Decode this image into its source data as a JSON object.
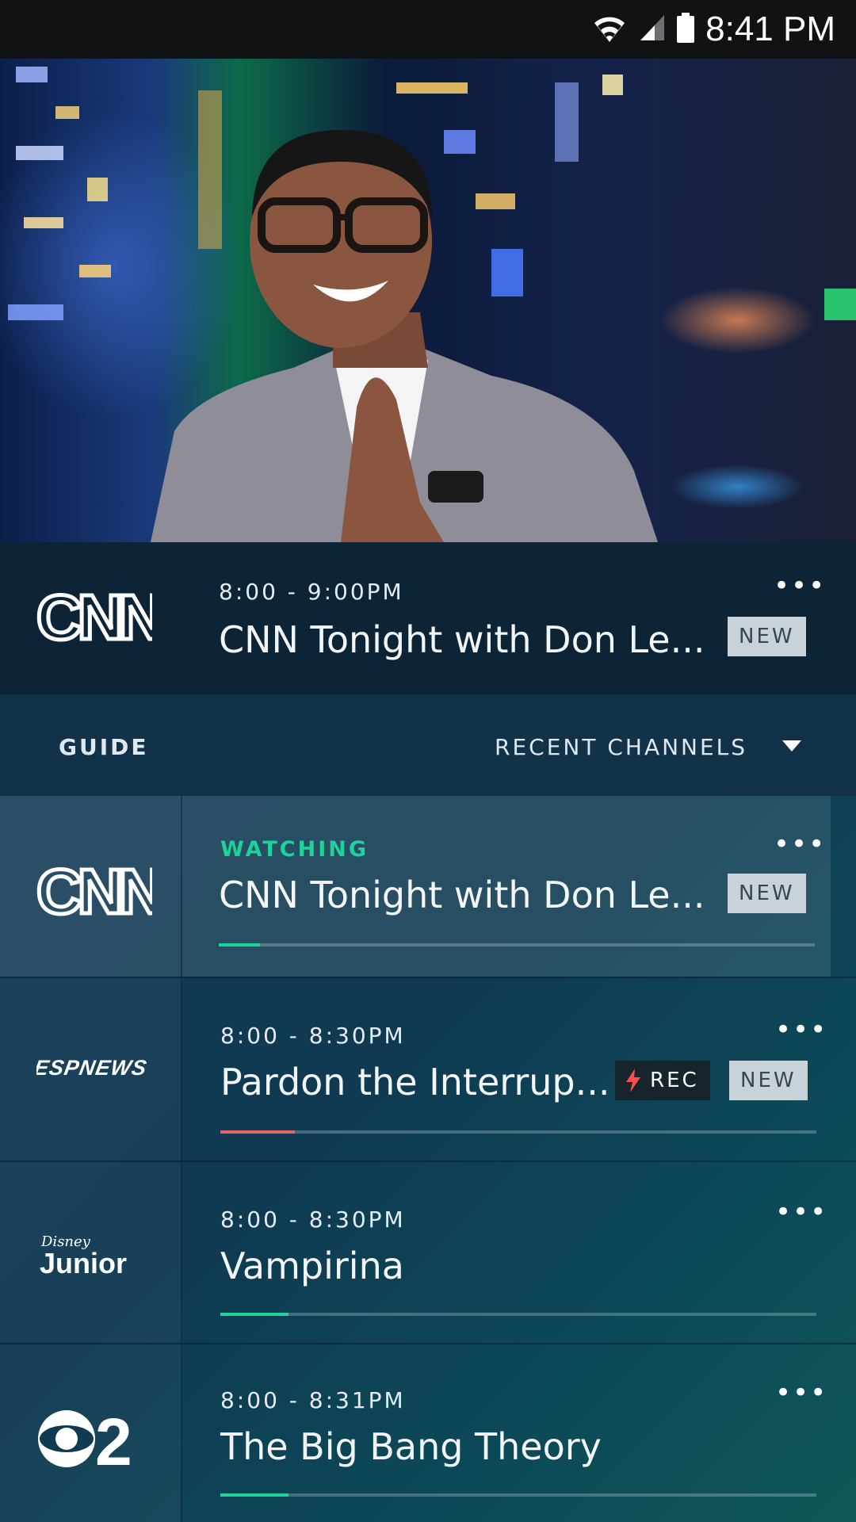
{
  "status_bar": {
    "time": "8:41 PM"
  },
  "now_playing": {
    "channel": "CNN",
    "time": "8:00 - 9:00PM",
    "title": "CNN Tonight with Don Le...",
    "badge": "NEW"
  },
  "guide_bar": {
    "guide_label": "GUIDE",
    "filter_label": "RECENT CHANNELS"
  },
  "guide_rows": [
    {
      "channel": "CNN",
      "status": "WATCHING",
      "time": "",
      "title": "CNN Tonight with Don Le...",
      "badges": [
        "NEW"
      ],
      "progress": 0.07,
      "progress_color": "#1ed39a"
    },
    {
      "channel": "ESPNEWS",
      "status": "",
      "time": "8:00 - 8:30PM",
      "title": "Pardon the Interrup...",
      "badges": [
        "REC",
        "NEW"
      ],
      "progress": 0.12,
      "progress_color": "#e5636a"
    },
    {
      "channel": "Disney Junior",
      "status": "",
      "time": "8:00 - 8:30PM",
      "title": "Vampirina",
      "badges": [],
      "progress": 0.11,
      "progress_color": "#1ed39a"
    },
    {
      "channel": "CBS 2",
      "status": "",
      "time": "8:00 - 8:31PM",
      "title": "The Big Bang Theory",
      "badges": [],
      "progress": 0.11,
      "progress_color": "#1ed39a"
    }
  ],
  "colors": {
    "accent_green": "#1ed39a",
    "rec_red": "#e5636a",
    "badge_bg": "#c9d2d8"
  },
  "icons": [
    "wifi-icon",
    "signal-icon",
    "battery-icon",
    "more-icon",
    "caret-down-icon",
    "lightning-icon"
  ]
}
